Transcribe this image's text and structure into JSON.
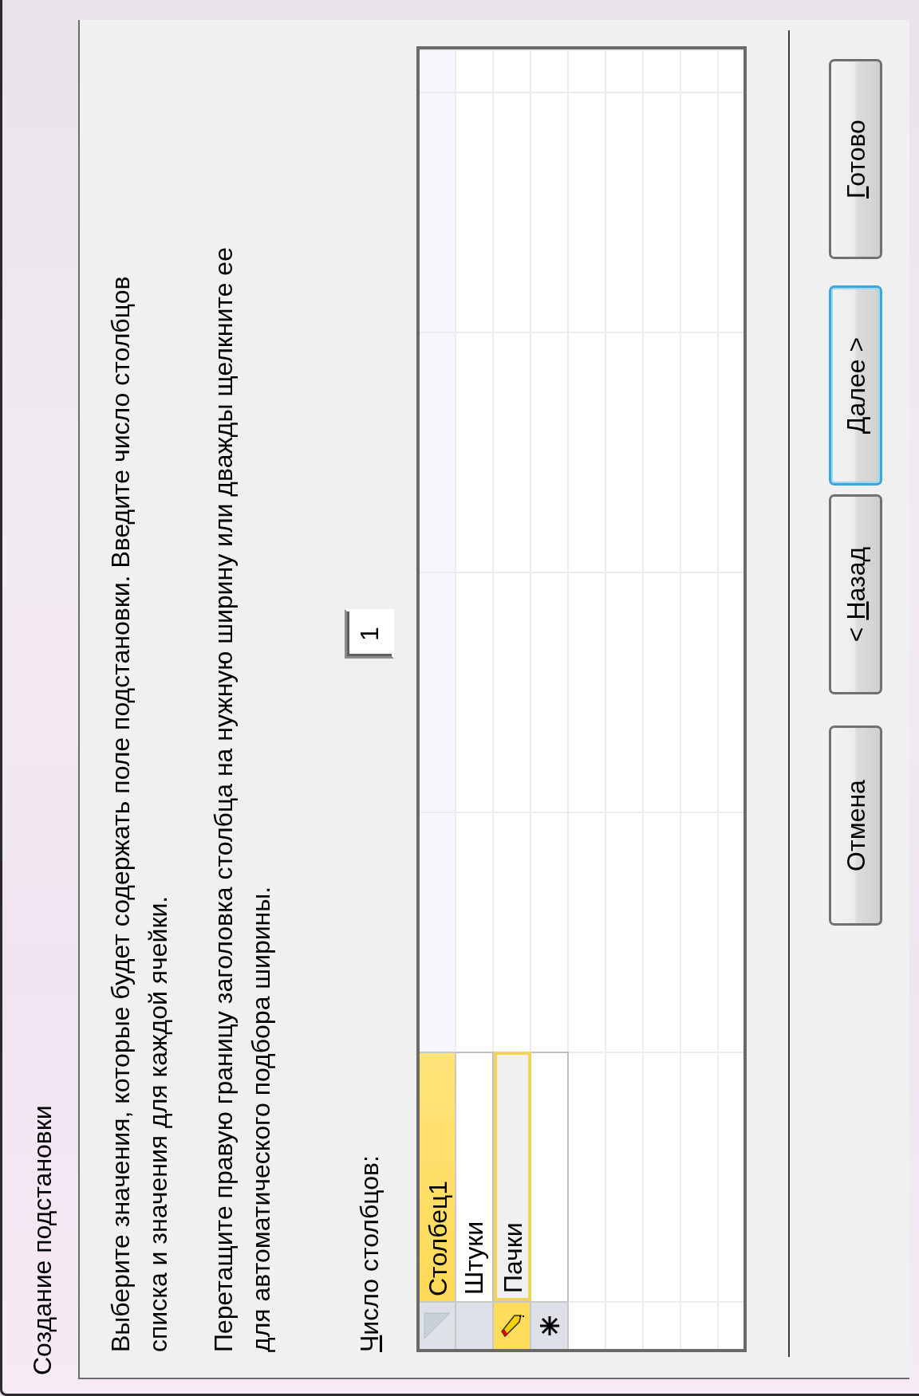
{
  "window": {
    "title": "Создание подстановки"
  },
  "instructions": [
    "Выберите значения, которые будет содержать поле подстановки. Введите число столбцов\nсписка и значения для каждой ячейки.",
    "Перетащите правую границу заголовка столбца на нужную ширину или дважды щелкните ее\nдля автоматического подбора ширины."
  ],
  "column_count": {
    "access_key": "Ч",
    "text_after": "исло столбцов:",
    "value": "1"
  },
  "table": {
    "columns": [
      {
        "label": "Столбец1"
      }
    ],
    "rows": [
      {
        "kind": "data",
        "cells": [
          "Штуки"
        ],
        "selected": false
      },
      {
        "kind": "data",
        "cells": [
          "Пачки"
        ],
        "selected": true
      },
      {
        "kind": "new",
        "selected": false
      }
    ]
  },
  "buttons": [
    {
      "text_before": "Отмена",
      "focused": false
    },
    {
      "text_before": "< ",
      "access_key": "Н",
      "text_after": "азад",
      "focused": false
    },
    {
      "access_key": "Д",
      "text_after": "алее >",
      "focused": true
    },
    {
      "access_key": "Г",
      "text_after": "отово",
      "focused": false
    }
  ]
}
